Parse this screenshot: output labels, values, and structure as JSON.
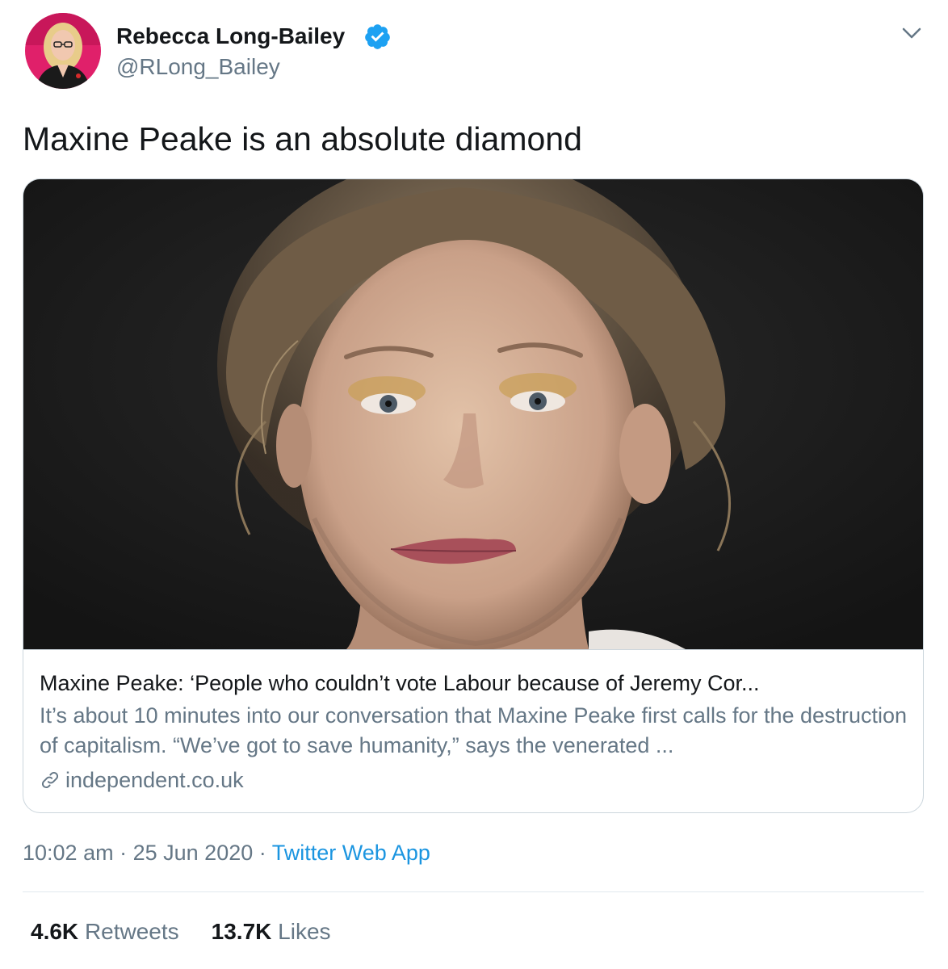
{
  "author": {
    "name": "Rebecca Long-Bailey",
    "handle": "@RLong_Bailey",
    "verified": true,
    "avatar": "profile-photo"
  },
  "icons": {
    "verified": "verified-badge-icon",
    "menu": "chevron-down-icon",
    "link": "link-icon"
  },
  "tweet": {
    "text": "Maxine Peake is an absolute diamond"
  },
  "card": {
    "image": "portrait-photo",
    "title": "Maxine Peake: ‘People who couldn’t vote Labour because of Jeremy Cor...",
    "description": "It’s about 10 minutes into our conversation that Maxine Peake first calls for the destruction of capitalism. “We’ve got to save humanity,” says the venerated ...",
    "domain": "independent.co.uk"
  },
  "meta": {
    "time": "10:02 am",
    "separator": "·",
    "date": "25 Jun 2020",
    "source": "Twitter Web App"
  },
  "stats": {
    "retweets_count": "4.6K",
    "retweets_label": "Retweets",
    "likes_count": "13.7K",
    "likes_label": "Likes"
  },
  "colors": {
    "accent": "#1b95e0",
    "verified": "#1da1f2",
    "secondary_text": "#657786",
    "primary_text": "#14171a",
    "border": "#ccd6dd"
  }
}
